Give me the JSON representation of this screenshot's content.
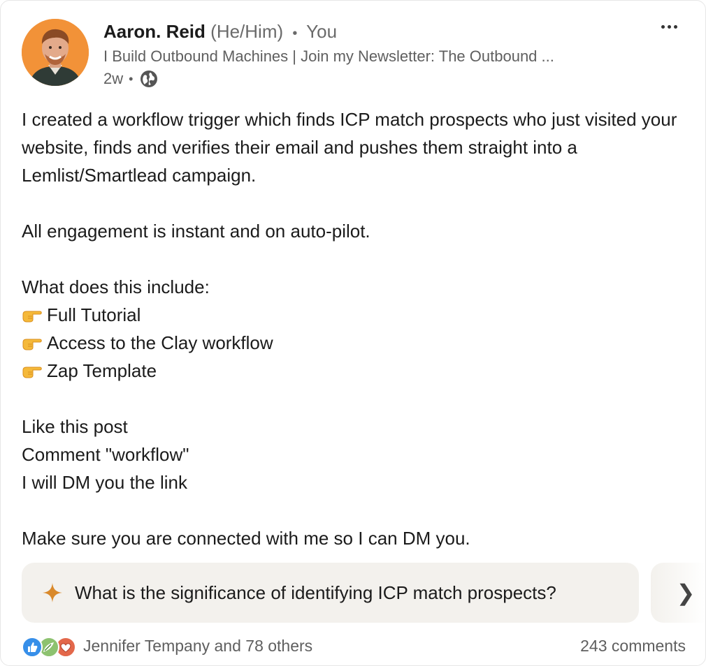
{
  "author": {
    "name": "Aaron. Reid",
    "pronouns": "(He/Him)",
    "relation": "You",
    "headline": "I Build Outbound Machines | Join my Newsletter: The Outbound ...",
    "time": "2w",
    "visibility_icon": "globe-icon"
  },
  "post": {
    "paragraph1": "I created a workflow trigger which finds ICP match prospects who just visited your website, finds and verifies their email and pushes them straight into a Lemlist/Smartlead campaign.",
    "paragraph2": "All engagement is instant and on auto-pilot.",
    "includes_heading": "What does this include:",
    "bullets": [
      "Full Tutorial",
      "Access to the Clay workflow",
      "Zap Template"
    ],
    "bullet_icon": "pointing-hand-icon",
    "cta1": "Like this post",
    "cta2": "Comment \"workflow\"",
    "cta3": "I will DM you the link",
    "closing": "Make sure you are connected with me so I can DM you."
  },
  "suggestion": {
    "icon": "sparkle-icon",
    "text": "What is the significance of identifying ICP match prospects?",
    "next_icon": "chevron-right-icon",
    "next_glyph": "❯"
  },
  "social": {
    "reactions": [
      "like-icon",
      "support-icon",
      "love-icon"
    ],
    "reactors_text": "Jennifer Tempany and 78 others",
    "comments_text": "243 comments"
  },
  "colors": {
    "like": "#378fe9",
    "support": "#8dc270",
    "love": "#e3684b",
    "sparkle": "#d9892b",
    "avatar_bg": "#f29238"
  }
}
